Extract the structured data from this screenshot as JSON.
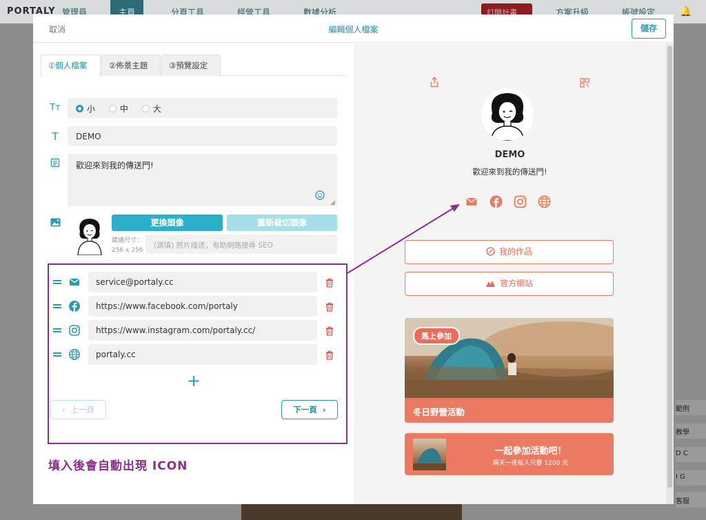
{
  "background": {
    "logo": "PORTALY",
    "nav": [
      "管理員",
      "主頁",
      "分頁工具",
      "經營工具",
      "數據分析"
    ],
    "plan_label": "訂閱計畫",
    "upgrade_label": "方案升級",
    "account_label": "帳號設定",
    "side_chips": [
      "範例",
      "教學",
      "D C",
      "I G",
      "客服"
    ]
  },
  "modal": {
    "cancel_label": "取消",
    "title": "編輯個人檔案",
    "save_label": "儲存"
  },
  "tabs": [
    "①個人檔案",
    "②佈景主題",
    "③預覽設定"
  ],
  "text_size": {
    "options": [
      "小",
      "中",
      "大"
    ],
    "selected": "小"
  },
  "name_field": {
    "value": "DEMO"
  },
  "bio_field": {
    "value": "歡迎來到我的傳送門!"
  },
  "avatar": {
    "change_label": "更換頭像",
    "recrop_label": "重新裁切頭像",
    "size_hint_1": "建議尺寸：",
    "size_hint_2": "256 x 256",
    "alt_placeholder": "(選填) 照片描述，有助網路搜尋 SEO"
  },
  "links": [
    {
      "icon": "mail-icon",
      "value": "service@portaly.cc"
    },
    {
      "icon": "facebook-icon",
      "value": "https://www.facebook.com/portaly"
    },
    {
      "icon": "instagram-icon",
      "value": "https://www.instagram.com/portaly.cc/"
    },
    {
      "icon": "globe-icon",
      "value": "portaly.cc"
    }
  ],
  "pager": {
    "prev_label": "上一頁",
    "next_label": "下一頁"
  },
  "annotation": "填入後會自動出現 ICON",
  "preview": {
    "name": "DEMO",
    "bio": "歡迎來到我的傳送門!",
    "buttons": [
      "我的作品",
      "官方網站"
    ],
    "event": {
      "badge": "馬上參加",
      "caption": "冬日野營活動"
    },
    "promo": {
      "title": "一起參加活動吧！",
      "subtitle": "兩天一夜每人只要 1200 元"
    }
  },
  "colors": {
    "teal": "#2a9bb0",
    "coral": "#ec7a63",
    "purple_annotation": "#8b2f8c",
    "trash_red": "#d9534f"
  }
}
